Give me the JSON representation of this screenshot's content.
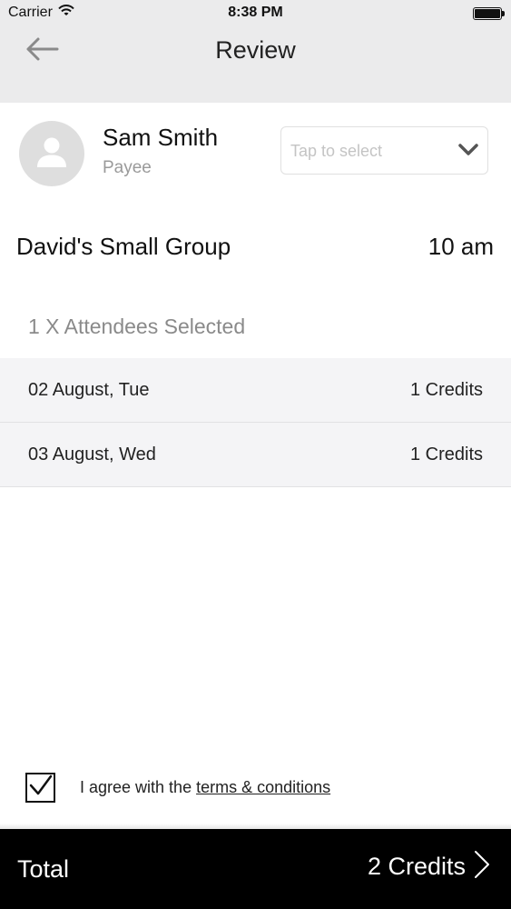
{
  "status_bar": {
    "carrier": "Carrier",
    "time": "8:38 PM"
  },
  "nav": {
    "title": "Review",
    "back_icon": "arrow-left-icon"
  },
  "payee": {
    "name": "Sam Smith",
    "role": "Payee",
    "select_placeholder": "Tap to select"
  },
  "group": {
    "name": "David's Small Group",
    "time": "10 am"
  },
  "attendees_summary": "1 X Attendees Selected",
  "sessions": [
    {
      "date": "02 August, Tue",
      "credits": "1 Credits"
    },
    {
      "date": "03 August, Wed",
      "credits": "1 Credits"
    }
  ],
  "agreement": {
    "checked": true,
    "text": "I agree with the ",
    "link": "terms & conditions"
  },
  "footer": {
    "label": "Total",
    "value": "2 Credits"
  },
  "colors": {
    "nav_bg": "#ebebec",
    "footer_bg": "#000000",
    "row_bg": "#f4f4f6"
  }
}
